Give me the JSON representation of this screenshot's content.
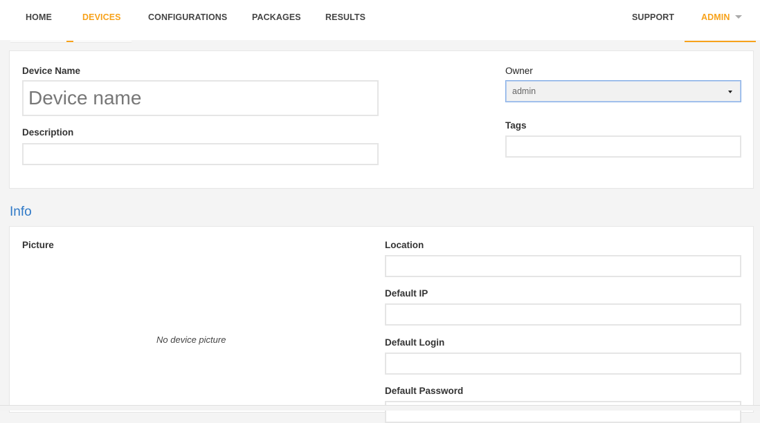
{
  "nav": {
    "items": [
      {
        "label": "HOME",
        "active": false
      },
      {
        "label": "DEVICES",
        "active": true
      },
      {
        "label": "CONFIGURATIONS",
        "active": false
      },
      {
        "label": "PACKAGES",
        "active": false
      },
      {
        "label": "RESULTS",
        "active": false
      }
    ],
    "support": "SUPPORT",
    "user": "ADMIN",
    "accent_color": "#f7a21b"
  },
  "general": {
    "device_name_label": "Device Name",
    "device_name_placeholder": "Device name",
    "device_name_value": "",
    "description_label": "Description",
    "description_value": "",
    "owner_label": "Owner",
    "owner_selected": "admin",
    "tags_label": "Tags",
    "tags_value": ""
  },
  "info": {
    "title": "Info",
    "title_color": "#2f79c7",
    "picture_label": "Picture",
    "no_picture_text": "No device picture",
    "location_label": "Location",
    "location_value": "",
    "default_ip_label": "Default IP",
    "default_ip_value": "",
    "default_login_label": "Default Login",
    "default_login_value": "",
    "default_password_label": "Default Password",
    "default_password_value": ""
  }
}
